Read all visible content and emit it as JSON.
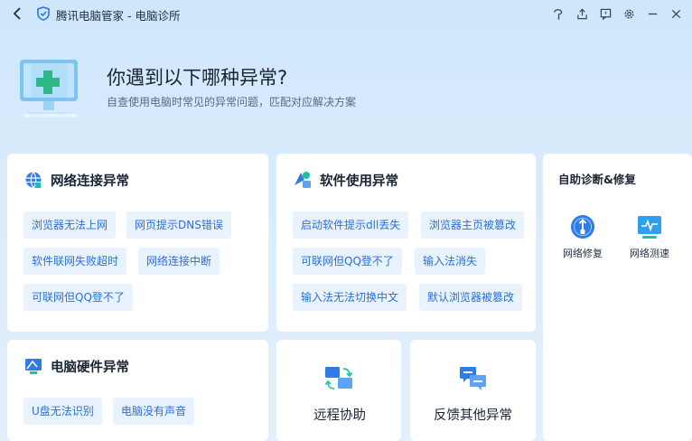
{
  "titlebar": {
    "title": "腾讯电脑管家 - 电脑诊所",
    "icons": [
      "back-icon",
      "shield-logo-icon",
      "skin-icon",
      "share-icon",
      "feedback-icon",
      "settings-icon",
      "minimize-icon",
      "close-icon"
    ]
  },
  "hero": {
    "title": "你遇到以下哪种异常?",
    "subtitle": "自查使用电脑时常见的异常问题，匹配对应解决方案"
  },
  "network": {
    "title": "网络连接异常",
    "items": [
      "浏览器无法上网",
      "网页提示DNS错误",
      "软件联网失败超时",
      "网络连接中断",
      "可联网但QQ登不了"
    ]
  },
  "software": {
    "title": "软件使用异常",
    "items": [
      "启动软件提示dll丢失",
      "浏览器主页被篡改",
      "可联网但QQ登不了",
      "输入法消失",
      "输入法无法切换中文",
      "默认浏览器被篡改"
    ]
  },
  "hardware": {
    "title": "电脑硬件异常",
    "items": [
      "U盘无法识别",
      "电脑没有声音"
    ]
  },
  "remote": {
    "label": "远程协助"
  },
  "feedback": {
    "label": "反馈其他异常"
  },
  "selfcheck": {
    "title": "自助诊断&修复",
    "tools": [
      {
        "label": "网络修复",
        "icon": "network-repair-icon"
      },
      {
        "label": "网络测速",
        "icon": "network-speed-icon"
      }
    ]
  },
  "colors": {
    "accent": "#2b6fd6",
    "chip_bg": "#e9f3ff",
    "background": "#d6eafb"
  }
}
